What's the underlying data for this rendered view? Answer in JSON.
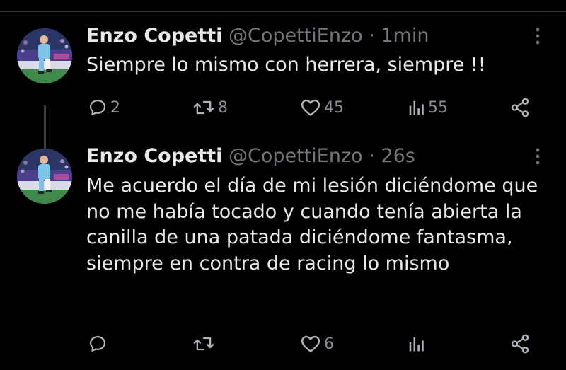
{
  "colors": {
    "background": "#000000",
    "text_primary": "#e7e9ea",
    "text_secondary": "#71767b",
    "thread_line": "#3e4144"
  },
  "tweets": [
    {
      "author": {
        "display_name": "Enzo Copetti",
        "handle": "@CopettiEnzo",
        "avatar_icon": "player-avatar-photo"
      },
      "separator": "·",
      "timestamp": "1min",
      "text": "Siempre lo mismo con herrera, siempre !!",
      "actions": {
        "reply_count": "2",
        "retweet_count": "8",
        "like_count": "45",
        "views_count": "55"
      }
    },
    {
      "author": {
        "display_name": "Enzo Copetti",
        "handle": "@CopettiEnzo",
        "avatar_icon": "player-avatar-photo"
      },
      "separator": "·",
      "timestamp": "26s",
      "text": "Me acuerdo el día de mi lesión diciéndome que no me había tocado y cuando tenía abierta la canilla de una patada diciéndome fantasma, siempre en contra de racing lo mismo",
      "actions": {
        "reply_count": "",
        "retweet_count": "",
        "like_count": "6",
        "views_count": ""
      }
    }
  ],
  "icons": {
    "reply": "reply-icon",
    "retweet": "retweet-icon",
    "like": "heart-icon",
    "views": "views-chart-icon",
    "share": "share-icon",
    "more": "more-options-icon"
  }
}
